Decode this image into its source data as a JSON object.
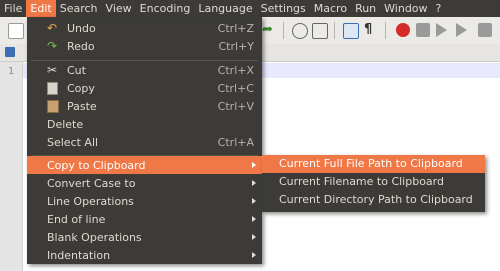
{
  "menubar": {
    "items": [
      "File",
      "Edit",
      "Search",
      "View",
      "Encoding",
      "Language",
      "Settings",
      "Macro",
      "Run",
      "Window",
      "?"
    ]
  },
  "editor": {
    "line_number": "1"
  },
  "edit_menu": {
    "items": [
      {
        "label": "Undo",
        "shortcut": "Ctrl+Z",
        "icon": "undo-icon"
      },
      {
        "label": "Redo",
        "shortcut": "Ctrl+Y",
        "icon": "redo-icon"
      },
      {
        "label": "Cut",
        "shortcut": "Ctrl+X",
        "icon": "cut-icon"
      },
      {
        "label": "Copy",
        "shortcut": "Ctrl+C",
        "icon": "copy-icon"
      },
      {
        "label": "Paste",
        "shortcut": "Ctrl+V",
        "icon": "paste-icon"
      },
      {
        "label": "Delete",
        "shortcut": ""
      },
      {
        "label": "Select All",
        "shortcut": "Ctrl+A"
      },
      {
        "label": "Copy to Clipboard",
        "submenu": true
      },
      {
        "label": "Convert Case to",
        "submenu": true
      },
      {
        "label": "Line Operations",
        "submenu": true
      },
      {
        "label": "End of line",
        "submenu": true
      },
      {
        "label": "Blank Operations",
        "submenu": true
      },
      {
        "label": "Indentation",
        "submenu": true
      }
    ]
  },
  "submenu": {
    "items": [
      "Current Full File Path to Clipboard",
      "Current Filename to Clipboard",
      "Current Directory Path to Clipboard"
    ]
  },
  "colors": {
    "menu_bg": "#3c3b37",
    "highlight": "#f07746",
    "text": "#dfdbd2"
  }
}
